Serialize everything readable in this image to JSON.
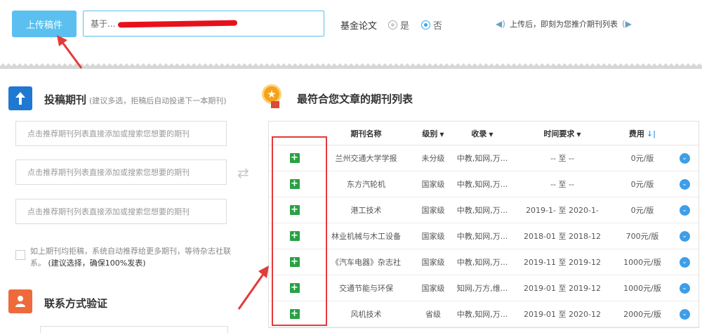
{
  "toolbar": {
    "upload_label": "上传稿件",
    "title_value": "基于...",
    "fund_label": "基金论文",
    "option_yes": "是",
    "option_no": "否",
    "selected": "否",
    "notice": "上传后，即刻为您推介期刊列表"
  },
  "submit": {
    "title": "投稿期刊",
    "hint": "(建议多选，拒稿后自动投递下一本期刊)",
    "placeholders": [
      "点击推荐期刊列表直接添加或搜索您想要的期刊",
      "点击推荐期刊列表直接添加或搜索您想要的期刊",
      "点击推荐期刊列表直接添加或搜索您想要的期刊"
    ],
    "auto_text": "如上期刊均拒稿，系统自动推荐给更多期刊，等待杂志社联系。",
    "auto_bold": "(建议选择，确保100%发表)"
  },
  "contact": {
    "title": "联系方式验证"
  },
  "recommend": {
    "title": "最符合您文章的期刊列表",
    "columns": {
      "name": "期刊名称",
      "level": "级别",
      "inclusion": "收录",
      "time": "时间要求",
      "fee": "费用"
    },
    "rows": [
      {
        "name": "兰州交通大学学报",
        "level": "未分级",
        "inclusion": "中教,知网,万...",
        "time": "-- 至 --",
        "fee": "0元/版"
      },
      {
        "name": "东方汽轮机",
        "level": "国家级",
        "inclusion": "中教,知网,万...",
        "time": "-- 至 --",
        "fee": "0元/版"
      },
      {
        "name": "港工技术",
        "level": "国家级",
        "inclusion": "中教,知网,万...",
        "time": "2019-1- 至 2020-1-",
        "fee": "0元/版"
      },
      {
        "name": "林业机械与木工设备",
        "level": "国家级",
        "inclusion": "中教,知网,万...",
        "time": "2018-01 至 2018-12",
        "fee": "700元/版"
      },
      {
        "name": "《汽车电器》杂志社",
        "level": "国家级",
        "inclusion": "中教,知网,万...",
        "time": "2019-11 至 2019-12",
        "fee": "1000元/版"
      },
      {
        "name": "交通节能与环保",
        "level": "国家级",
        "inclusion": "知网,万方,维...",
        "time": "2019-01 至 2019-12",
        "fee": "1000元/版"
      },
      {
        "name": "风机技术",
        "level": "省级",
        "inclusion": "中教,知网,万...",
        "time": "2019-01 至 2020-12",
        "fee": "2000元/版"
      }
    ]
  },
  "colors": {
    "accent": "#5bc0ef",
    "add": "#2aa144",
    "annotation": "#e33a3a"
  }
}
